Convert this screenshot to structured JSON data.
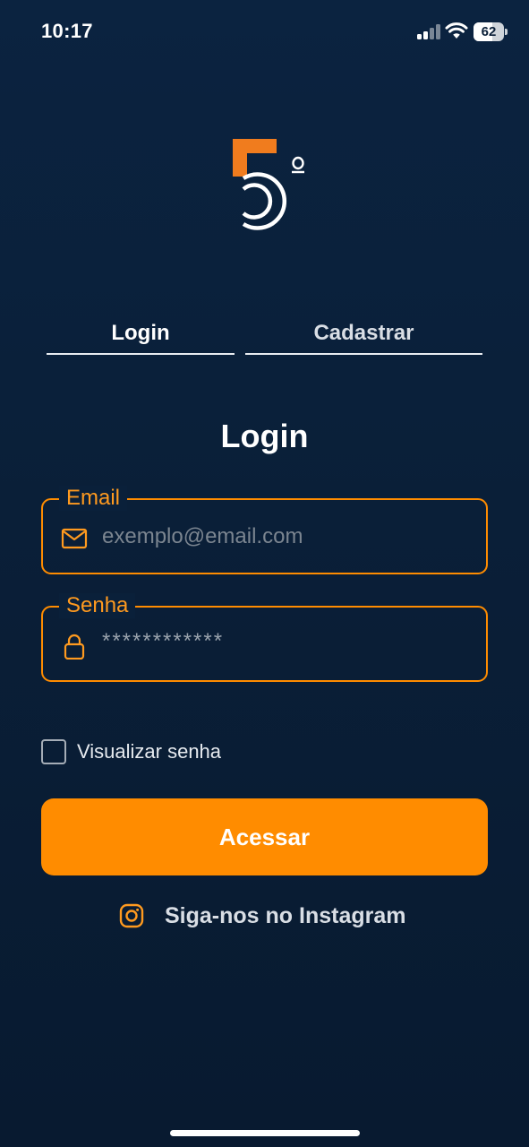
{
  "status_bar": {
    "time": "10:17",
    "battery_level": "62",
    "battery_fraction": 0.62
  },
  "logo": {
    "digit": "5",
    "ordinal": "º",
    "accent_color": "#f07c1e"
  },
  "tabs": [
    {
      "label": "Login",
      "active": true
    },
    {
      "label": "Cadastrar",
      "active": false
    }
  ],
  "form": {
    "heading": "Login",
    "email": {
      "label": "Email",
      "icon": "mail-icon",
      "placeholder": "exemplo@email.com",
      "value": ""
    },
    "password": {
      "label": "Senha",
      "icon": "lock-icon",
      "placeholder": "************",
      "value": ""
    },
    "show_password": {
      "label": "Visualizar senha",
      "checked": false
    },
    "submit_label": "Acessar"
  },
  "instagram": {
    "icon": "instagram-icon",
    "label": "Siga-nos no Instagram"
  },
  "colors": {
    "background": "#0a1f38",
    "accent": "#ff8c00",
    "text": "#ffffff"
  }
}
